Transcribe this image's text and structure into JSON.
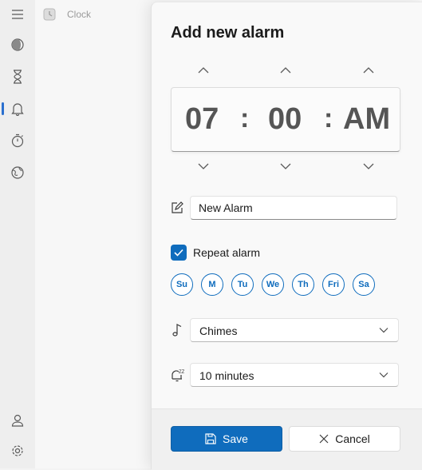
{
  "app": {
    "title": "Clock"
  },
  "nav": {
    "items": [
      {
        "icon": "menu-icon"
      },
      {
        "icon": "focus-sessions-icon"
      },
      {
        "icon": "timer-icon"
      },
      {
        "icon": "alarm-bell-icon",
        "selected": true
      },
      {
        "icon": "stopwatch-icon"
      },
      {
        "icon": "world-clock-icon"
      },
      {
        "icon": "account-icon"
      },
      {
        "icon": "settings-icon"
      }
    ],
    "accent": "#2a6fcf"
  },
  "dialog": {
    "title": "Add new alarm",
    "time": {
      "hour": "07",
      "separator": ":",
      "minute": "00",
      "period": "AM"
    },
    "name_field": {
      "value": "New Alarm",
      "icon": "edit-icon"
    },
    "repeat": {
      "label": "Repeat alarm",
      "checked": true
    },
    "days": [
      {
        "label": "Su"
      },
      {
        "label": "M"
      },
      {
        "label": "Tu"
      },
      {
        "label": "We"
      },
      {
        "label": "Th"
      },
      {
        "label": "Fri"
      },
      {
        "label": "Sa"
      }
    ],
    "sound": {
      "value": "Chimes",
      "icon": "music-note-icon"
    },
    "snooze": {
      "value": "10 minutes",
      "icon": "snooze-icon"
    },
    "save_label": "Save",
    "cancel_label": "Cancel"
  },
  "colors": {
    "accent": "#0f6cbd",
    "dialog_bg": "#f9f9f9"
  }
}
